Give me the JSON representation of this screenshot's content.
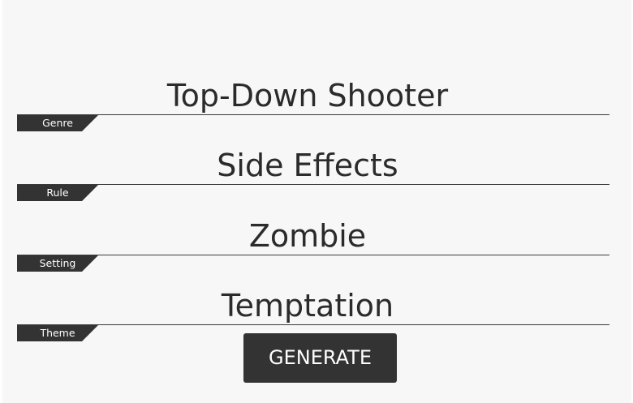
{
  "rows": [
    {
      "value": "Top-Down Shooter",
      "label": "Genre"
    },
    {
      "value": "Side Effects",
      "label": "Rule"
    },
    {
      "value": "Zombie",
      "label": "Setting"
    },
    {
      "value": "Temptation",
      "label": "Theme"
    }
  ],
  "generate_label": "GENERATE",
  "colors": {
    "background": "#f7f7f7",
    "text": "#2b2b2b",
    "tag_background": "#333333",
    "button_background": "#333333",
    "button_text": "#ffffff"
  }
}
